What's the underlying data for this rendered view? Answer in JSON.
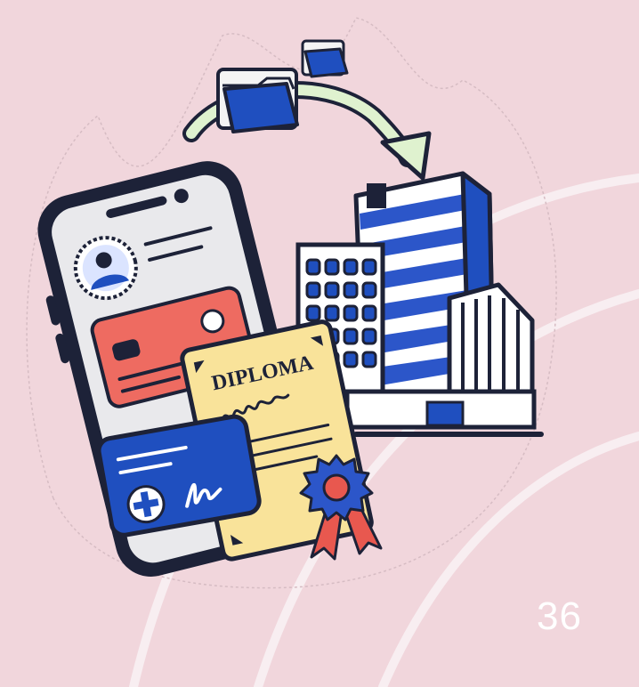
{
  "slide": {
    "page_number": "36",
    "background_color": "#f1d6dc"
  },
  "illustration": {
    "diploma_text": "DIPLOMA",
    "colors": {
      "phone_frame": "#1d2238",
      "phone_screen": "#e9e9ec",
      "id_card": "#ee6b61",
      "health_card": "#1f4fbf",
      "diploma": "#f9e39a",
      "ribbon": "#e8584f",
      "rosette": "#2c56c9",
      "building_stripes": "#2c56c9",
      "arrow": "#dff2cf"
    }
  }
}
